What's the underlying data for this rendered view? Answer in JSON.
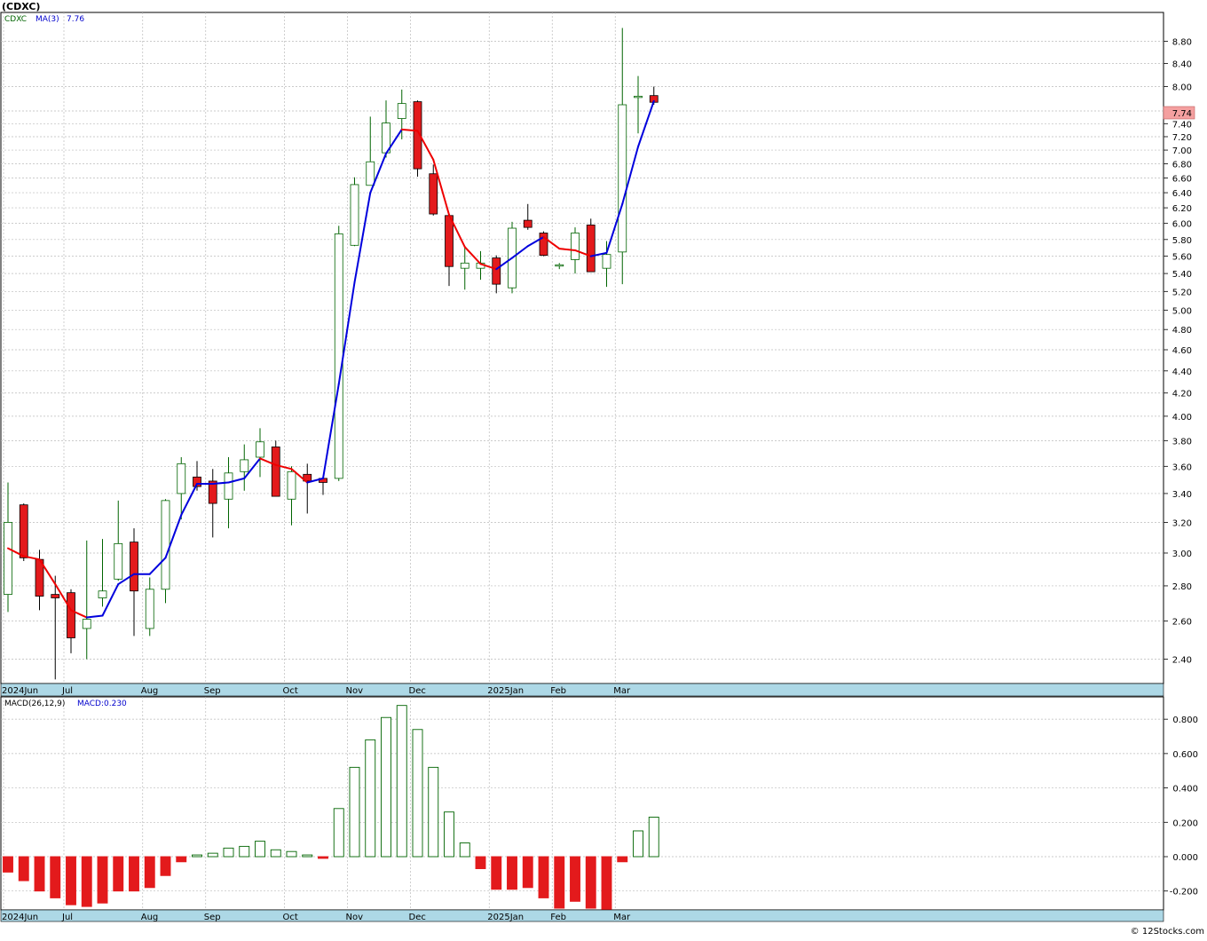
{
  "chart_title": "(CDXC)",
  "footer_credit": "© 12Stocks.com",
  "chart_data": [
    {
      "type": "candlestick",
      "ticker": "CDXC",
      "legend": {
        "ticker": "CDXC",
        "ma_label": "MA(3)",
        "ma_value": "7.76"
      },
      "last_price_label": "7.74",
      "y_ticks": [
        "2.40",
        "2.60",
        "2.80",
        "3.00",
        "3.20",
        "3.40",
        "3.60",
        "3.80",
        "4.00",
        "4.20",
        "4.40",
        "4.60",
        "4.80",
        "5.00",
        "5.20",
        "5.40",
        "5.60",
        "5.80",
        "6.00",
        "6.20",
        "6.40",
        "6.60",
        "6.80",
        "7.00",
        "7.20",
        "7.40",
        "7.60",
        "8.00",
        "8.40",
        "8.80"
      ],
      "y_scale": "log",
      "ylim": [
        2.28,
        9.35
      ],
      "x_ticks": [
        {
          "label": "2024Jun",
          "index": 0
        },
        {
          "label": "Jul",
          "index": 4
        },
        {
          "label": "Aug",
          "index": 9
        },
        {
          "label": "Sep",
          "index": 13
        },
        {
          "label": "Oct",
          "index": 18
        },
        {
          "label": "Nov",
          "index": 22
        },
        {
          "label": "Dec",
          "index": 26
        },
        {
          "label": "2025Jan",
          "index": 31
        },
        {
          "label": "Feb",
          "index": 35
        },
        {
          "label": "Mar",
          "index": 39
        }
      ],
      "candles": [
        {
          "o": 2.75,
          "h": 3.48,
          "l": 2.65,
          "c": 3.2
        },
        {
          "o": 3.32,
          "h": 3.33,
          "l": 2.95,
          "c": 2.97
        },
        {
          "o": 2.96,
          "h": 3.02,
          "l": 2.66,
          "c": 2.74
        },
        {
          "o": 2.75,
          "h": 2.86,
          "l": 2.3,
          "c": 2.73
        },
        {
          "o": 2.76,
          "h": 2.78,
          "l": 2.43,
          "c": 2.51
        },
        {
          "o": 2.56,
          "h": 3.08,
          "l": 2.4,
          "c": 2.61
        },
        {
          "o": 2.73,
          "h": 3.09,
          "l": 2.68,
          "c": 2.77
        },
        {
          "o": 2.84,
          "h": 3.35,
          "l": 2.83,
          "c": 3.06
        },
        {
          "o": 3.07,
          "h": 3.16,
          "l": 2.52,
          "c": 2.77
        },
        {
          "o": 2.56,
          "h": 2.85,
          "l": 2.52,
          "c": 2.78
        },
        {
          "o": 2.78,
          "h": 3.36,
          "l": 2.7,
          "c": 3.35
        },
        {
          "o": 3.4,
          "h": 3.67,
          "l": 3.22,
          "c": 3.62
        },
        {
          "o": 3.52,
          "h": 3.64,
          "l": 3.42,
          "c": 3.45
        },
        {
          "o": 3.49,
          "h": 3.58,
          "l": 3.1,
          "c": 3.33
        },
        {
          "o": 3.36,
          "h": 3.67,
          "l": 3.16,
          "c": 3.55
        },
        {
          "o": 3.56,
          "h": 3.77,
          "l": 3.42,
          "c": 3.65
        },
        {
          "o": 3.67,
          "h": 3.9,
          "l": 3.52,
          "c": 3.79
        },
        {
          "o": 3.75,
          "h": 3.8,
          "l": 3.38,
          "c": 3.38
        },
        {
          "o": 3.36,
          "h": 3.6,
          "l": 3.18,
          "c": 3.56
        },
        {
          "o": 3.54,
          "h": 3.62,
          "l": 3.26,
          "c": 3.49
        },
        {
          "o": 3.51,
          "h": 3.52,
          "l": 3.39,
          "c": 3.48
        },
        {
          "o": 3.51,
          "h": 5.97,
          "l": 3.49,
          "c": 5.87
        },
        {
          "o": 5.73,
          "h": 6.61,
          "l": 5.72,
          "c": 6.51
        },
        {
          "o": 6.5,
          "h": 7.51,
          "l": 6.5,
          "c": 6.83
        },
        {
          "o": 6.96,
          "h": 7.77,
          "l": 6.89,
          "c": 7.41
        },
        {
          "o": 7.48,
          "h": 7.95,
          "l": 7.16,
          "c": 7.72
        },
        {
          "o": 7.75,
          "h": 7.77,
          "l": 6.62,
          "c": 6.73
        },
        {
          "o": 6.66,
          "h": 6.79,
          "l": 6.1,
          "c": 6.12
        },
        {
          "o": 6.1,
          "h": 6.12,
          "l": 5.26,
          "c": 5.48
        },
        {
          "o": 5.46,
          "h": 5.71,
          "l": 5.22,
          "c": 5.52
        },
        {
          "o": 5.46,
          "h": 5.66,
          "l": 5.33,
          "c": 5.52
        },
        {
          "o": 5.58,
          "h": 5.61,
          "l": 5.18,
          "c": 5.28
        },
        {
          "o": 5.24,
          "h": 6.02,
          "l": 5.18,
          "c": 5.94
        },
        {
          "o": 6.04,
          "h": 6.25,
          "l": 5.92,
          "c": 5.95
        },
        {
          "o": 5.88,
          "h": 5.9,
          "l": 5.6,
          "c": 5.61
        },
        {
          "o": 5.5,
          "h": 5.52,
          "l": 5.45,
          "c": 5.5
        },
        {
          "o": 5.56,
          "h": 5.95,
          "l": 5.4,
          "c": 5.88
        },
        {
          "o": 5.98,
          "h": 6.06,
          "l": 5.42,
          "c": 5.42
        },
        {
          "o": 5.46,
          "h": 5.78,
          "l": 5.25,
          "c": 5.62
        },
        {
          "o": 5.65,
          "h": 9.05,
          "l": 5.28,
          "c": 7.7
        },
        {
          "o": 7.82,
          "h": 8.18,
          "l": 7.25,
          "c": 7.84
        },
        {
          "o": 7.85,
          "h": 8.0,
          "l": 7.7,
          "c": 7.74
        }
      ],
      "ma3": [
        3.03,
        2.98,
        2.96,
        2.81,
        2.66,
        2.62,
        2.63,
        2.81,
        2.87,
        2.87,
        2.97,
        3.25,
        3.47,
        3.47,
        3.48,
        3.51,
        3.66,
        3.61,
        3.58,
        3.48,
        3.51,
        4.28,
        5.3,
        6.4,
        6.95,
        7.31,
        7.29,
        6.86,
        6.11,
        5.71,
        5.51,
        5.45,
        5.58,
        5.72,
        5.83,
        5.69,
        5.67,
        5.6,
        5.64,
        6.25,
        7.05,
        7.76
      ],
      "macd": {
        "legend_label": "MACD(26,12,9)",
        "value_label": "MACD:0.230",
        "y_ticks": [
          "0.800",
          "0.600",
          "0.400",
          "0.200",
          "0.000",
          "-0.200"
        ],
        "ylim": [
          -0.31,
          0.93
        ],
        "histogram": [
          -0.09,
          -0.14,
          -0.2,
          -0.24,
          -0.28,
          -0.29,
          -0.27,
          -0.2,
          -0.2,
          -0.18,
          -0.11,
          -0.03,
          0.01,
          0.02,
          0.05,
          0.06,
          0.09,
          0.04,
          0.03,
          0.01,
          -0.01,
          0.28,
          0.52,
          0.68,
          0.81,
          0.88,
          0.74,
          0.52,
          0.26,
          0.08,
          -0.07,
          -0.19,
          -0.19,
          -0.18,
          -0.24,
          -0.3,
          -0.26,
          -0.3,
          -0.31,
          -0.03,
          0.15,
          0.23
        ]
      }
    }
  ]
}
